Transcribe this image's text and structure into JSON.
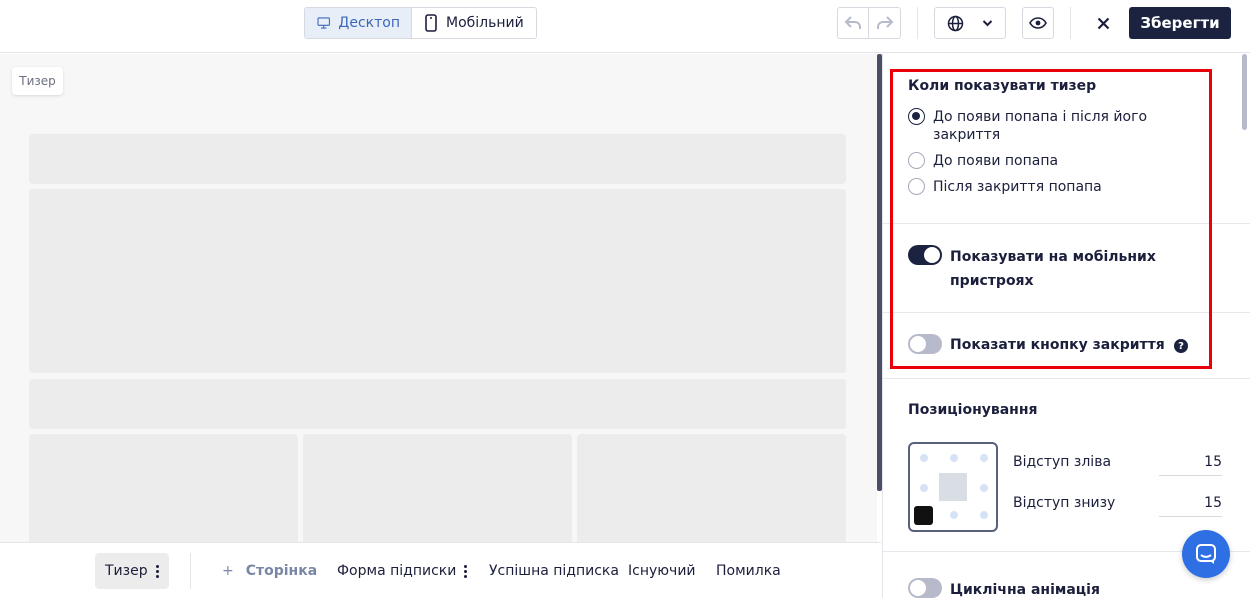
{
  "topbar": {
    "desktop_label": "Десктоп",
    "mobile_label": "Мобільний",
    "save_label": "Зберегти",
    "icons": [
      "desktop-icon",
      "mobile-icon",
      "undo-icon",
      "redo-icon",
      "globe-icon",
      "chevron-down-icon",
      "eye-icon",
      "close-icon"
    ]
  },
  "canvas": {
    "teaser_chip": "Тизер"
  },
  "bottombar": {
    "tabs": [
      "Тизер",
      "+ Сторінка",
      "Форма підписки",
      "Успішна підписка",
      "Існуючий",
      "Помилка"
    ],
    "active_tab": "Тизер",
    "add_page_label": "Сторінка"
  },
  "panel": {
    "when_show": {
      "title": "Коли показувати тизер",
      "options": [
        {
          "label": "До появи попапа і після його закриття",
          "checked": true
        },
        {
          "label": "До появи попапа",
          "checked": false
        },
        {
          "label": "Після закриття попапа",
          "checked": false
        }
      ]
    },
    "show_mobile": {
      "label": "Показувати на мобільних пристроях",
      "enabled": true
    },
    "show_close": {
      "label": "Показати кнопку закриття",
      "enabled": false
    },
    "positioning": {
      "title": "Позиціонування",
      "offset_left_label": "Відступ зліва",
      "offset_left_value": "15",
      "offset_bottom_label": "Відступ знизу",
      "offset_bottom_value": "15",
      "selected_position": "bottom-left"
    },
    "cyclic_animation": {
      "label": "Циклічна анімація",
      "enabled": false
    }
  },
  "colors": {
    "accent": "#1c2340",
    "highlight_box": "#e8000b",
    "chat_button": "#2f6fe4",
    "active_tab_text": "#3b67b8"
  }
}
